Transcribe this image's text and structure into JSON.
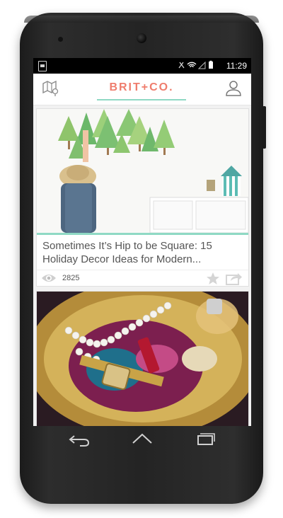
{
  "status_bar": {
    "time": "11:29"
  },
  "app_bar": {
    "logo_text": "BRIT+CO."
  },
  "feed": {
    "cards": [
      {
        "title": "Sometimes It’s Hip to be Square: 15 Holiday Decor Ideas for Modern...",
        "views": "2825"
      }
    ]
  },
  "colors": {
    "accent": "#8fd9c4",
    "logo": "#ef7d6d"
  },
  "icons": [
    "map-icon",
    "user-icon",
    "eye-icon",
    "star-icon",
    "share-icon",
    "back-icon",
    "home-icon",
    "recents-icon"
  ]
}
